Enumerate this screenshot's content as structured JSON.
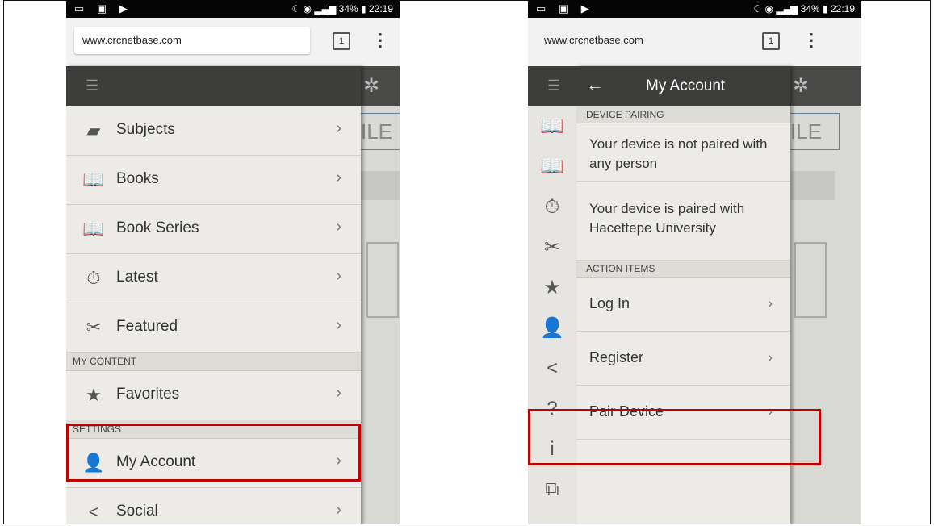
{
  "status": {
    "time": "22:19",
    "battery": "34%"
  },
  "browser": {
    "url": "www.crcnetbase.com",
    "tab_count": "1"
  },
  "background": {
    "partial_text": "ILE"
  },
  "left_drawer": {
    "items": [
      {
        "label": "Subjects",
        "icon": "folder-icon"
      },
      {
        "label": "Books",
        "icon": "book-icon"
      },
      {
        "label": "Book Series",
        "icon": "book-series-icon"
      },
      {
        "label": "Latest",
        "icon": "timer-icon"
      },
      {
        "label": "Featured",
        "icon": "ribbon-icon"
      }
    ],
    "my_content_header": "MY CONTENT",
    "favorites": "Favorites",
    "settings_header": "SETTINGS",
    "my_account": "My Account",
    "social": "Social"
  },
  "right_panel": {
    "title": "My Account",
    "device_pairing_header": "DEVICE PAIRING",
    "not_paired": "Your device is not paired with any person",
    "paired_with": "Your device is paired with Hacettepe University",
    "action_items_header": "ACTION ITEMS",
    "log_in": "Log In",
    "register": "Register",
    "pair_device": "Pair Device"
  },
  "colors": {
    "highlight": "#c00000",
    "header": "#3d3d3b"
  }
}
